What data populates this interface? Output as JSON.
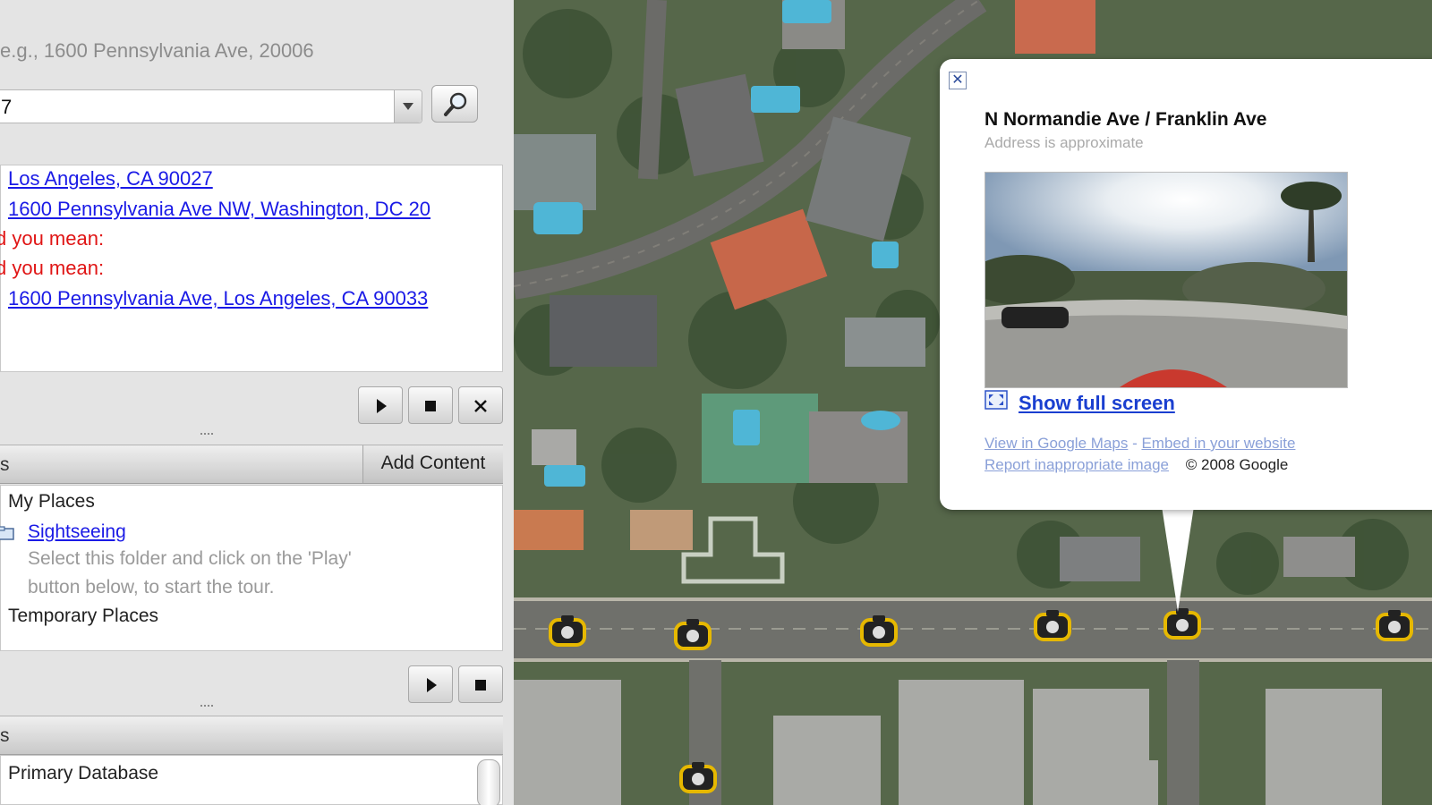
{
  "search": {
    "hint": "e.g., 1600 Pennsylvania Ave, 20006",
    "query_value": "7"
  },
  "results": [
    {
      "text": "Los Angeles, CA 90027",
      "kind": "link"
    },
    {
      "text": "1600 Pennsylvania Ave NW, Washington, DC 20",
      "kind": "link"
    },
    {
      "text": "d you mean:",
      "kind": "suggest"
    },
    {
      "text": "d you mean:",
      "kind": "suggest"
    },
    {
      "text": "1600 Pennsylvania Ave, Los Angeles, CA 90033",
      "kind": "link"
    }
  ],
  "places_panel": {
    "header_label": "s",
    "add_content_label": "Add Content",
    "my_places": "My Places",
    "sightseeing": "Sightseeing",
    "sightseeing_desc_1": "Select this folder and click on the 'Play'",
    "sightseeing_desc_2": "button below, to start the tour.",
    "temporary_places": "Temporary Places"
  },
  "layers_panel": {
    "header_label": "s",
    "primary_database": "Primary Database"
  },
  "popup": {
    "title": "N Normandie Ave / Franklin Ave",
    "subtitle": "Address is approximate",
    "show_full_screen": "Show full screen",
    "view_in_maps": "View in Google Maps",
    "separator": " - ",
    "embed": "Embed in your website",
    "report": "Report inappropriate image",
    "copyright": "© 2008 Google"
  },
  "colors": {
    "link": "#1a1ae6",
    "suggest_red": "#e01515",
    "camera_ring": "#e6b800"
  },
  "icons": [
    "magnifier-icon",
    "dropdown-arrow-icon",
    "play-icon",
    "stop-icon",
    "close-icon",
    "folder-icon",
    "fullscreen-icon",
    "streetview-camera-icon"
  ]
}
